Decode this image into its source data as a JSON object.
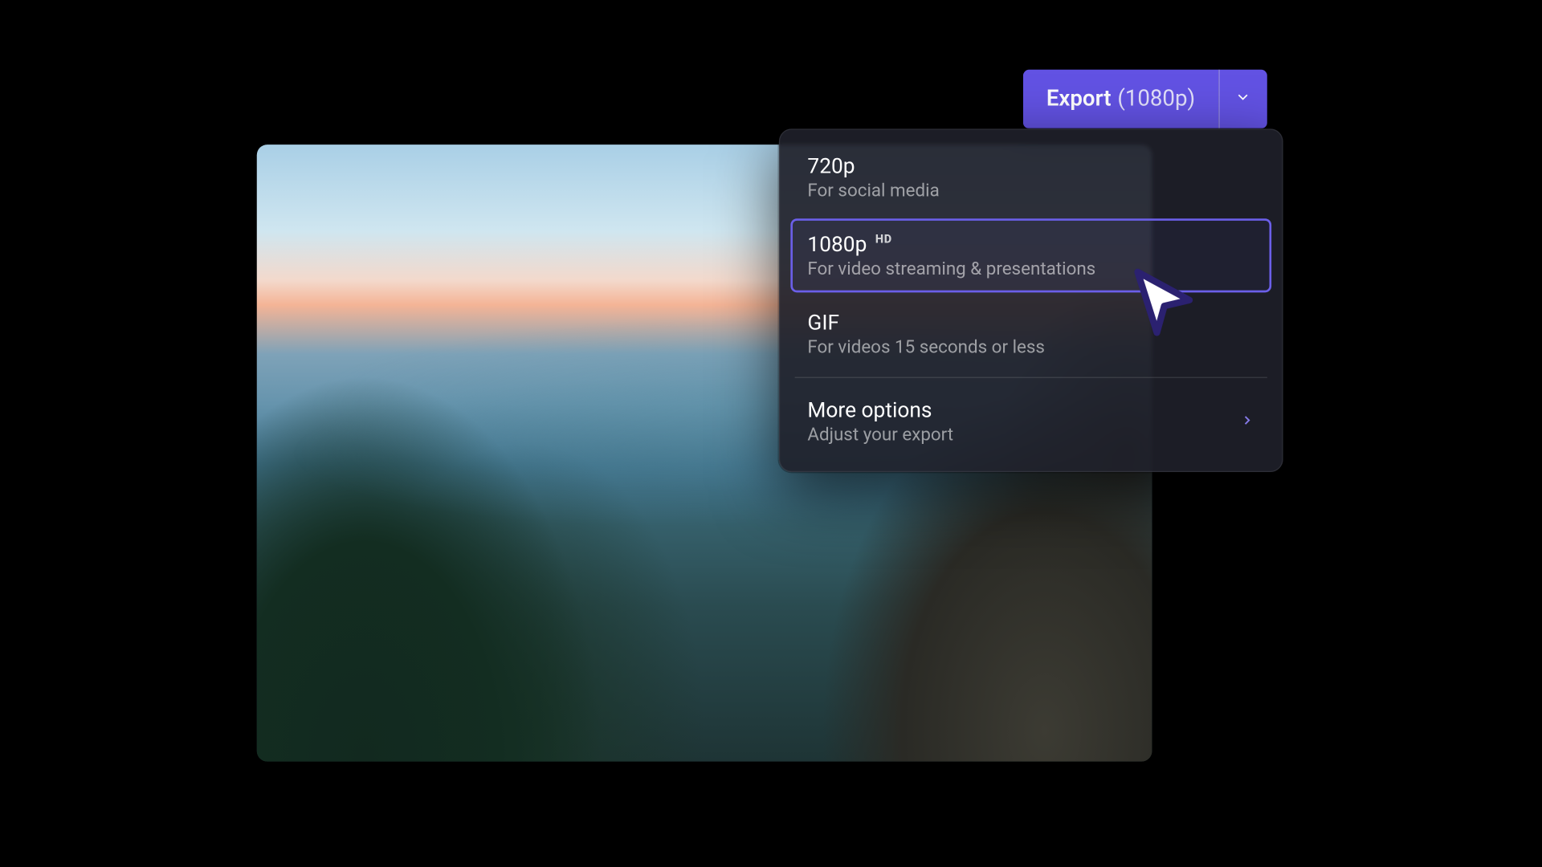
{
  "export_button": {
    "label": "Export",
    "current_resolution": "(1080p)"
  },
  "options": [
    {
      "title": "720p",
      "subtitle": "For social media"
    },
    {
      "title": "1080p",
      "subtitle": "For video streaming & presentations",
      "badge": "HD",
      "selected": true
    },
    {
      "title": "GIF",
      "subtitle": "For videos 15 seconds or less"
    }
  ],
  "more": {
    "title": "More options",
    "subtitle": "Adjust your export"
  },
  "colors": {
    "accent": "#6252e3",
    "panel": "#1e2029"
  }
}
